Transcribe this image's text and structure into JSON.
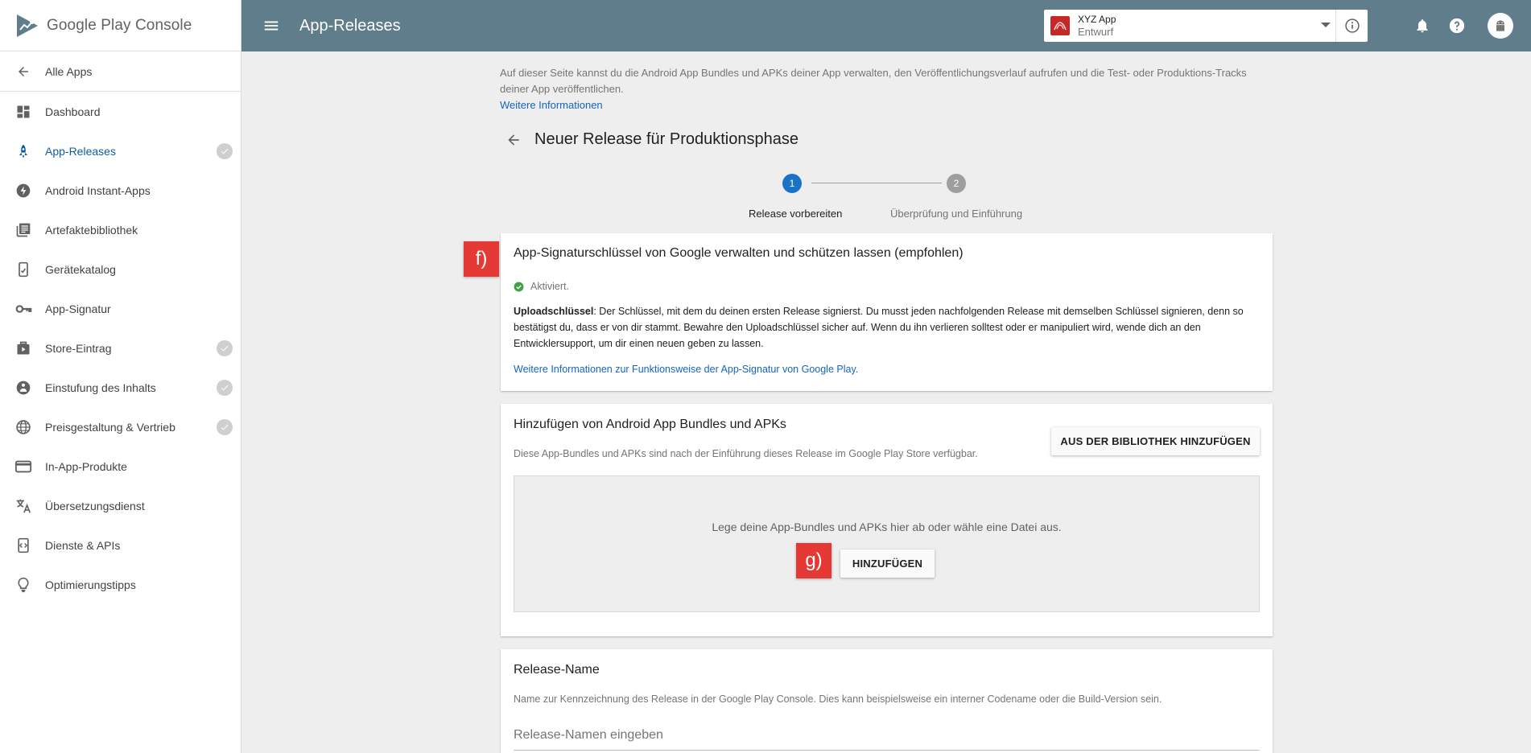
{
  "sidebar": {
    "logo_text": "Google Play Console",
    "back_label": "Alle Apps",
    "items": [
      {
        "label": "Dashboard",
        "icon": "dashboard-icon",
        "active": false,
        "check": false
      },
      {
        "label": "App-Releases",
        "icon": "rocket-icon",
        "active": true,
        "check": true
      },
      {
        "label": "Android Instant-Apps",
        "icon": "bolt-icon",
        "active": false,
        "check": false
      },
      {
        "label": "Artefaktebibliothek",
        "icon": "library-icon",
        "active": false,
        "check": false
      },
      {
        "label": "Gerätekatalog",
        "icon": "device-icon",
        "active": false,
        "check": false
      },
      {
        "label": "App-Signatur",
        "icon": "key-icon",
        "active": false,
        "check": false
      },
      {
        "label": "Store-Eintrag",
        "icon": "store-icon",
        "active": false,
        "check": true
      },
      {
        "label": "Einstufung des Inhalts",
        "icon": "rating-icon",
        "active": false,
        "check": true
      },
      {
        "label": "Preisgestaltung & Vertrieb",
        "icon": "globe-icon",
        "active": false,
        "check": true
      },
      {
        "label": "In-App-Produkte",
        "icon": "card-icon",
        "active": false,
        "check": false
      },
      {
        "label": "Übersetzungsdienst",
        "icon": "translate-icon",
        "active": false,
        "check": false
      },
      {
        "label": "Dienste & APIs",
        "icon": "api-icon",
        "active": false,
        "check": false
      },
      {
        "label": "Optimierungstipps",
        "icon": "lightbulb-icon",
        "active": false,
        "check": false
      }
    ]
  },
  "topbar": {
    "title": "App-Releases",
    "app_name": "XYZ App",
    "app_status": "Entwurf"
  },
  "intro": {
    "text": "Auf dieser Seite kannst du die Android App Bundles und APKs deiner App verwalten, den Veröffentlichungsverlauf aufrufen und die Test- oder Produktions-Tracks deiner App veröffentlichen.",
    "link": "Weitere Informationen"
  },
  "page": {
    "title": "Neuer Release für Produktionsphase"
  },
  "stepper": {
    "step1_number": "1",
    "step1_label": "Release vorbereiten",
    "step2_number": "2",
    "step2_label": "Überprüfung und Einführung"
  },
  "signing_card": {
    "marker": "f)",
    "title": "App-Signaturschlüssel von Google verwalten und schützen lassen (empfohlen)",
    "status": "Aktiviert.",
    "upload_key_label": "Uploadschlüssel",
    "upload_key_text": ": Der Schlüssel, mit dem du deinen ersten Release signierst. Du musst jeden nachfolgenden Release mit demselben Schlüssel signieren, denn so bestätigst du, dass er von dir stammt. Bewahre den Uploadschlüssel sicher auf. Wenn du ihn verlieren solltest oder er manipuliert wird, wende dich an den Entwicklersupport, um dir einen neuen geben zu lassen.",
    "link": "Weitere Informationen zur Funktionsweise der App-Signatur von Google Play."
  },
  "bundles_card": {
    "title": "Hinzufügen von Android App Bundles und APKs",
    "subtitle": "Diese App-Bundles und APKs sind nach der Einführung dieses Release im Google Play Store verfügbar.",
    "library_button": "AUS DER BIBLIOTHEK HINZUFÜGEN",
    "drop_text": "Lege deine App-Bundles und APKs hier ab oder wähle eine Datei aus.",
    "add_button": "HINZUFÜGEN",
    "marker": "g)"
  },
  "release_card": {
    "title": "Release-Name",
    "subtitle": "Name zur Kennzeichnung des Release in der Google Play Console. Dies kann beispielsweise ein interner Codename oder die Build-Version sein.",
    "input_placeholder": "Release-Namen eingeben"
  },
  "colors": {
    "topbar": "#607d8b",
    "accent": "#0d5c9e",
    "step_active": "#1a73c8",
    "step_inactive": "#9e9e9e",
    "marker": "#e53935",
    "success": "#43a047"
  }
}
